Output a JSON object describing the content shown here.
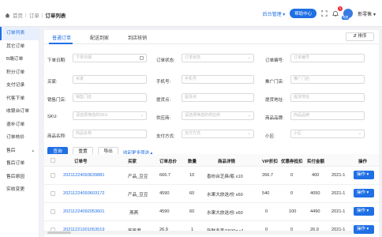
{
  "breadcrumb": {
    "home": "首页",
    "level2": "订单",
    "current": "订单列表"
  },
  "topbar": {
    "admin_label": "后台管理",
    "admin_caret": "▾",
    "help_label": "帮助中心",
    "notification_count": "5",
    "avatar_tag": "概要",
    "store_name": "新零售",
    "store_caret": "▾"
  },
  "sidebar": {
    "items": [
      {
        "label": "订单列表"
      },
      {
        "label": "其它订单"
      },
      {
        "label": "B端订单"
      },
      {
        "label": "积分订单"
      },
      {
        "label": "支付记录"
      },
      {
        "label": "代客下单"
      },
      {
        "label": "收银台订单"
      },
      {
        "label": "退补订单"
      },
      {
        "label": "订单核价"
      },
      {
        "label": "售后",
        "caret": "▴"
      },
      {
        "label": "售后订单"
      },
      {
        "label": "售后原因"
      },
      {
        "label": "实收变更"
      }
    ]
  },
  "tabs": [
    {
      "label": "普通订单"
    },
    {
      "label": "配送到家"
    },
    {
      "label": "到店核销"
    }
  ],
  "sort_button": "⇵ 排序",
  "filters": {
    "order_date": {
      "label": "下单日期:",
      "placeholder": "下单日期"
    },
    "order_status": {
      "label": "订单状态:",
      "placeholder": "订单状态"
    },
    "order_no": {
      "label": "订单编号:",
      "placeholder": "订单编号"
    },
    "buyer": {
      "label": "买家:",
      "placeholder": "买家"
    },
    "phone": {
      "label": "手机号:",
      "placeholder": "手机号"
    },
    "promoter_store": {
      "label": "推广门店:",
      "placeholder": "推广门店"
    },
    "sales_store": {
      "label": "销售门店:",
      "placeholder": "销售门店"
    },
    "pickup_store": {
      "label": "提货点:",
      "placeholder": "提货点"
    },
    "pickup_address": {
      "label": "提货地址:",
      "placeholder": "提货地址"
    },
    "sku": {
      "label": "SKU:",
      "placeholder": "请选择筛选的SKU"
    },
    "supplier": {
      "label": "供应商:",
      "placeholder": "请选择筛选的供应商"
    },
    "brand": {
      "label": "商品品牌:",
      "placeholder": "商品品牌"
    },
    "product_name": {
      "label": "商品名称:",
      "placeholder": "商品名称"
    },
    "payment_method": {
      "label": "支付方式:",
      "placeholder": "支付方式"
    },
    "community": {
      "label": "小区:",
      "placeholder": "小区"
    }
  },
  "actions": {
    "query": "查询",
    "reset": "重置",
    "export": "导出",
    "more_filters": "收起更多筛选 ▴"
  },
  "table": {
    "headers": [
      "订单号",
      "买家",
      "订单总价",
      "数量",
      "商品详情",
      "VIP折扣",
      "优惠券抵扣",
      "实付金额",
      "",
      "操作"
    ],
    "rows": [
      {
        "order_no": "20211224093639881",
        "buyer": "产品_豆豆",
        "total": "666.7",
        "qty": "10",
        "detail": "香纷台芝麻/瓶 x10",
        "vip": "266.7",
        "coupon": "0",
        "paid": "400",
        "date": "2021-1"
      },
      {
        "order_no": "20211224093603172",
        "buyer": "产品_豆豆",
        "total": "4590",
        "qty": "60",
        "detail": "水果大放送/份 x60",
        "vip": "540",
        "coupon": "0",
        "paid": "4050",
        "date": "2021-1"
      },
      {
        "order_no": "20211224092053601",
        "buyer": "燕燕",
        "total": "4590",
        "qty": "60",
        "detail": "水果大放送/份 x60",
        "vip": "0",
        "coupon": "100",
        "paid": "4490",
        "date": "2021-1"
      },
      {
        "order_no": "20211221001053519",
        "buyer": "笨笨君",
        "total": "26.9",
        "qty": "1",
        "detail": "新鲜冬枣/1500g x1",
        "vip": "0",
        "coupon": "0",
        "paid": "26.9",
        "date": "2021-1"
      }
    ],
    "op_label": "操作 ▾"
  },
  "colors": {
    "primary": "#1f6fe5",
    "badge": "#f5222d"
  }
}
